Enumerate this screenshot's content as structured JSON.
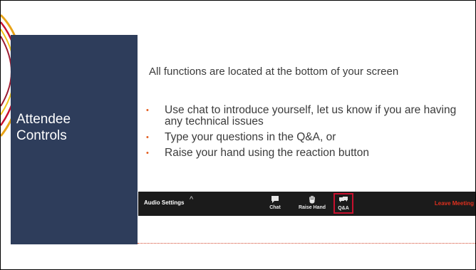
{
  "slide": {
    "title": "Attendee Controls",
    "intro": "All functions are located at the bottom of your screen",
    "bullets": [
      "Use chat to introduce yourself, let us know if you are having any technical issues",
      "Type your questions in the Q&A, or",
      "Raise your hand using the reaction button"
    ]
  },
  "toolbar": {
    "audio_settings_label": "Audio Settings",
    "audio_caret_icon": "chevron-up-icon",
    "buttons": [
      {
        "label": "Chat",
        "icon": "chat-icon"
      },
      {
        "label": "Raise Hand",
        "icon": "hand-icon"
      },
      {
        "label": "Q&A",
        "icon": "qa-icon",
        "highlighted": true
      }
    ],
    "leave_label": "Leave Meeting"
  },
  "colors": {
    "panel": "#2e3d5b",
    "bullet": "#e35d1e",
    "toolbar_bg": "#1b1b1b",
    "highlight": "#c8102e",
    "leave": "#e0301e",
    "divider": "#d4442a"
  }
}
